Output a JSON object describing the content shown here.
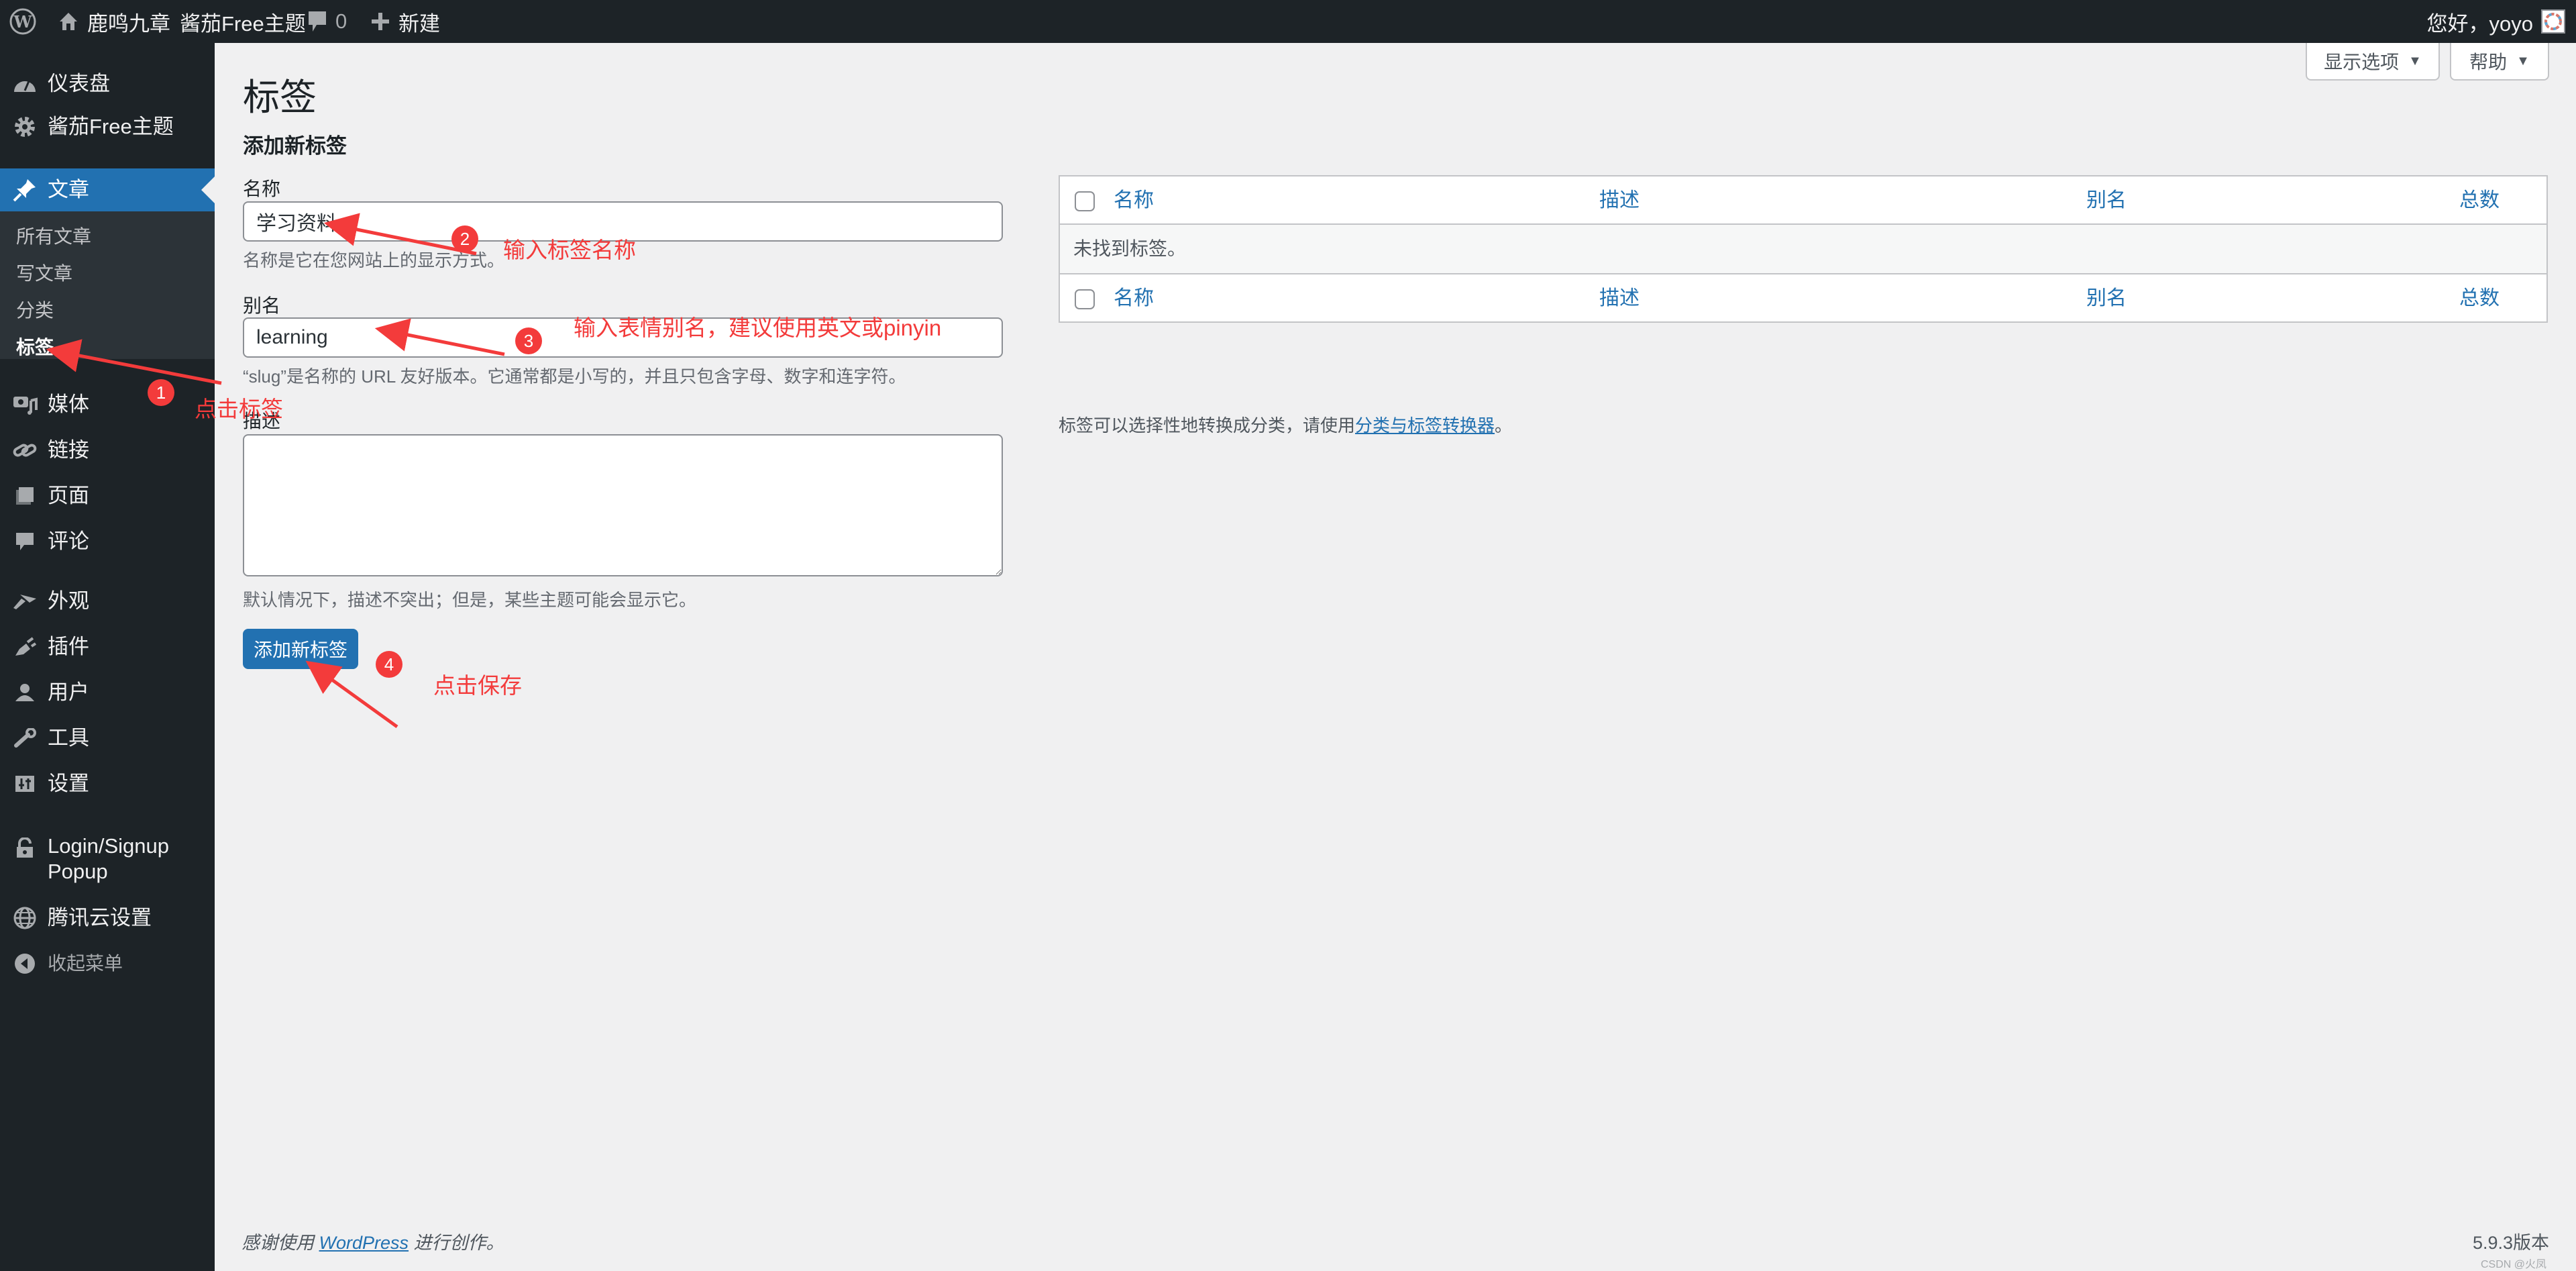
{
  "adminbar": {
    "wp_logo": "wordpress-logo-icon",
    "site_name": "鹿鸣九章",
    "theme_link": "酱茄Free主题",
    "comments_count": "0",
    "new_label": "新建",
    "greeting": "您好，yoyo"
  },
  "sidebar": {
    "items": [
      {
        "label": "仪表盘",
        "icon": "dashboard-icon"
      },
      {
        "label": "酱茄Free主题",
        "icon": "gear-icon"
      },
      {
        "label": "文章",
        "icon": "pushpin-icon",
        "current": true
      },
      {
        "label": "媒体",
        "icon": "media-icon"
      },
      {
        "label": "链接",
        "icon": "link-icon"
      },
      {
        "label": "页面",
        "icon": "pages-icon"
      },
      {
        "label": "评论",
        "icon": "comment-icon"
      },
      {
        "label": "外观",
        "icon": "appearance-icon"
      },
      {
        "label": "插件",
        "icon": "plugin-icon"
      },
      {
        "label": "用户",
        "icon": "user-icon"
      },
      {
        "label": "工具",
        "icon": "wrench-icon"
      },
      {
        "label": "设置",
        "icon": "settings-icon"
      },
      {
        "label": "Login/Signup Popup",
        "line1": "Login/Signup",
        "line2": "Popup",
        "icon": "lock-icon"
      },
      {
        "label": "腾讯云设置",
        "icon": "globe-icon"
      },
      {
        "label": "收起菜单",
        "icon": "collapse-icon"
      }
    ],
    "submenu": [
      {
        "label": "所有文章"
      },
      {
        "label": "写文章"
      },
      {
        "label": "分类"
      },
      {
        "label": "标签",
        "current": true
      }
    ]
  },
  "screen_meta": {
    "screen_options": "显示选项",
    "help": "帮助"
  },
  "page": {
    "title": "标签",
    "form_title": "添加新标签",
    "name_label": "名称",
    "name_value": "学习资料",
    "name_help": "名称是它在您网站上的显示方式。",
    "slug_label": "别名",
    "slug_value": "learning",
    "slug_help": "“slug”是名称的 URL 友好版本。它通常都是小写的，并且只包含字母、数字和连字符。",
    "desc_label": "描述",
    "desc_value": "",
    "desc_help": "默认情况下，描述不突出；但是，某些主题可能会显示它。",
    "submit_label": "添加新标签"
  },
  "table": {
    "columns": [
      "名称",
      "描述",
      "别名",
      "总数"
    ],
    "empty_message": "未找到标签。",
    "convert_note_prefix": "标签可以选择性地转换成分类，请使用",
    "convert_link": "分类与标签转换器",
    "convert_note_suffix": "。"
  },
  "footer": {
    "thanks_prefix": "感谢使用",
    "thanks_link": "WordPress",
    "thanks_suffix": "进行创作。",
    "version": "5.9.3版本",
    "watermark": "CSDN @火凤"
  },
  "annotations": [
    {
      "step": "1",
      "text": "点击标签"
    },
    {
      "step": "2",
      "text": "输入标签名称"
    },
    {
      "step": "3",
      "text": "输入表情别名，建议使用英文或pinyin"
    },
    {
      "step": "4",
      "text": "点击保存"
    }
  ],
  "colors": {
    "accent": "#2271b1",
    "adminbar_bg": "#1d2327",
    "annotation_red": "#f33b3b"
  }
}
